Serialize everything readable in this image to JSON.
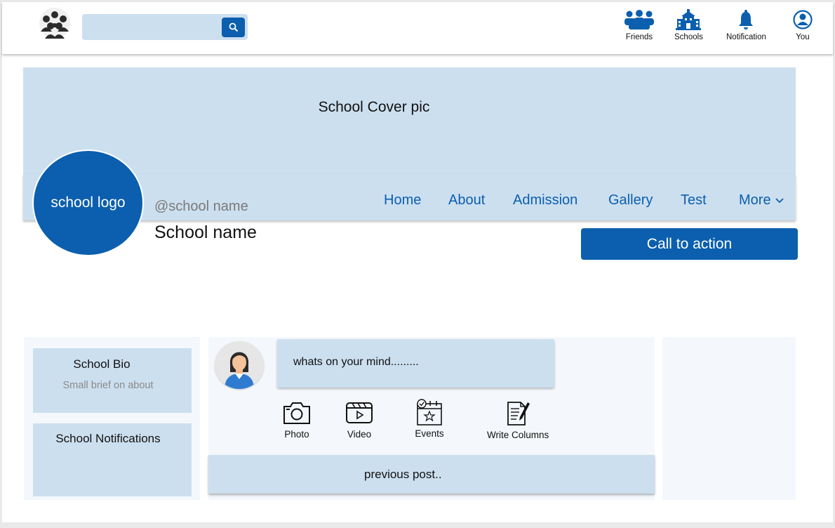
{
  "topnav": {
    "search": {
      "placeholder": "",
      "value": ""
    },
    "items": [
      {
        "label": "Friends",
        "icon": "friends-icon"
      },
      {
        "label": "Schools",
        "icon": "school-building-icon"
      },
      {
        "label": "Notification",
        "icon": "bell-icon"
      },
      {
        "label": "You",
        "icon": "user-circle-icon"
      }
    ]
  },
  "profile": {
    "cover_text": "School Cover pic",
    "logo_text": "school logo",
    "handle": "@school name",
    "name": "School name",
    "cta_label": "Call to action",
    "tabs": [
      "Home",
      "About",
      "Admission",
      "Gallery",
      "Test",
      "More"
    ]
  },
  "sidebar": {
    "bio_title": "School Bio",
    "bio_subtitle": "Small brief on about",
    "notifications_title": "School Notifications"
  },
  "composer": {
    "prompt": "whats on your  mind.........",
    "actions": [
      {
        "label": "Photo",
        "icon": "camera-icon"
      },
      {
        "label": "Video",
        "icon": "video-icon"
      },
      {
        "label": "Events",
        "icon": "calendar-event-icon"
      },
      {
        "label": "Write Columns",
        "icon": "write-document-icon"
      }
    ],
    "previous_label": "previous post.."
  },
  "colors": {
    "accent": "#0b5fae",
    "panel": "#ccdfef",
    "card_bg": "#f4f8fc"
  }
}
